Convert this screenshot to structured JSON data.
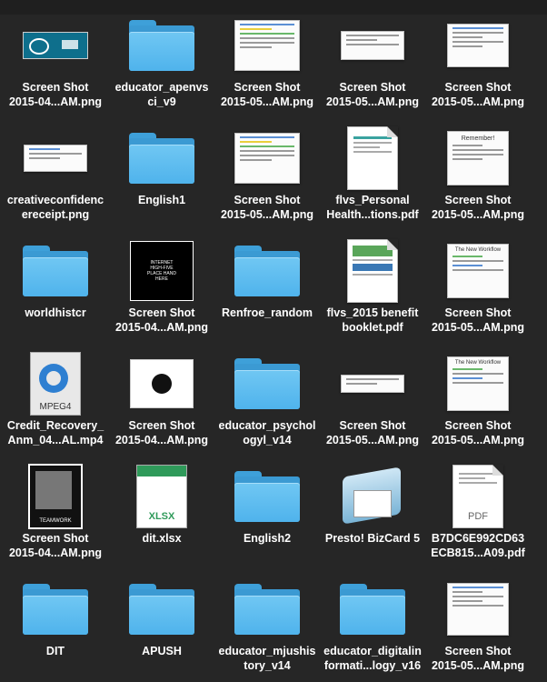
{
  "files": [
    {
      "label": "Screen Shot\n2015-04...AM.png",
      "icon": "screenshot-icon"
    },
    {
      "label": "educator_apenvs\nci_v9",
      "icon": "folder-icon"
    },
    {
      "label": "Screen Shot\n2015-05...AM.png",
      "icon": "screenshot-icon"
    },
    {
      "label": "Screen Shot\n2015-05...AM.png",
      "icon": "screenshot-icon"
    },
    {
      "label": "Screen Shot\n2015-05...AM.png",
      "icon": "screenshot-icon"
    },
    {
      "label": "creativeconfidenc\nereceipt.png",
      "icon": "image-icon"
    },
    {
      "label": "English1",
      "icon": "folder-icon"
    },
    {
      "label": "Screen Shot\n2015-05...AM.png",
      "icon": "screenshot-icon"
    },
    {
      "label": "flvs_Personal\nHealth...tions.pdf",
      "icon": "pdf-icon"
    },
    {
      "label": "Screen Shot\n2015-05...AM.png",
      "icon": "screenshot-icon"
    },
    {
      "label": "worldhistcr",
      "icon": "folder-icon"
    },
    {
      "label": "Screen Shot\n2015-04...AM.png",
      "icon": "screenshot-icon",
      "thumb_text": "INTERNET\nHIGH-FIVE\nPLACE HAND\nHERE"
    },
    {
      "label": "Renfroe_random",
      "icon": "folder-icon"
    },
    {
      "label": "flvs_2015 benefit\nbooklet.pdf",
      "icon": "pdf-icon"
    },
    {
      "label": "Screen Shot\n2015-05...AM.png",
      "icon": "screenshot-icon",
      "thumb_text": "The New Workflow"
    },
    {
      "label": "Credit_Recovery_\nAnm_04...AL.mp4",
      "icon": "video-icon",
      "thumb_text": "MPEG4"
    },
    {
      "label": "Screen Shot\n2015-04...AM.png",
      "icon": "screenshot-icon"
    },
    {
      "label": "educator_psychol\nogyl_v14",
      "icon": "folder-icon"
    },
    {
      "label": "Screen Shot\n2015-05...AM.png",
      "icon": "screenshot-icon"
    },
    {
      "label": "Screen Shot\n2015-05...AM.png",
      "icon": "screenshot-icon",
      "thumb_text": "The New Workflow"
    },
    {
      "label": "Screen Shot\n2015-04...AM.png",
      "icon": "screenshot-icon",
      "thumb_text": "TEAMWORK"
    },
    {
      "label": "dit.xlsx",
      "icon": "spreadsheet-icon",
      "thumb_text": "XLSX"
    },
    {
      "label": "English2",
      "icon": "folder-icon"
    },
    {
      "label": "Presto! BizCard 5",
      "icon": "app-icon"
    },
    {
      "label": "B7DC6E992CD63\nECB815...A09.pdf",
      "icon": "pdf-icon",
      "thumb_text": "PDF"
    },
    {
      "label": "DIT",
      "icon": "folder-icon"
    },
    {
      "label": "APUSH",
      "icon": "folder-icon"
    },
    {
      "label": "educator_mjushis\ntory_v14",
      "icon": "folder-icon"
    },
    {
      "label": "educator_digitalin\nformati...logy_v16",
      "icon": "folder-icon"
    },
    {
      "label": "Screen Shot\n2015-05...AM.png",
      "icon": "screenshot-icon"
    }
  ],
  "remember_thumb": {
    "title": "Remember!"
  },
  "colors": {
    "background": "#262626",
    "folder": "#4fb3ec",
    "label": "#ffffff"
  }
}
